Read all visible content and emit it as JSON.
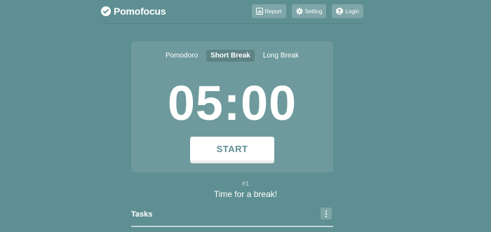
{
  "app": {
    "name": "Pomofocus",
    "accent_color": "#5e8f92"
  },
  "nav": {
    "report": {
      "label": "Report",
      "icon": "bar-chart-icon"
    },
    "setting": {
      "label": "Setting",
      "icon": "gear-icon"
    },
    "login": {
      "label": "Login",
      "icon": "user-circle-icon"
    }
  },
  "timer": {
    "modes": [
      {
        "label": "Pomodoro",
        "active": false
      },
      {
        "label": "Short Break",
        "active": true
      },
      {
        "label": "Long Break",
        "active": false
      }
    ],
    "time": "05:00",
    "start_label": "START"
  },
  "session": {
    "count": "#1",
    "message": "Time for a break!"
  },
  "tasks": {
    "title": "Tasks",
    "menu_icon": "kebab-menu-icon"
  }
}
